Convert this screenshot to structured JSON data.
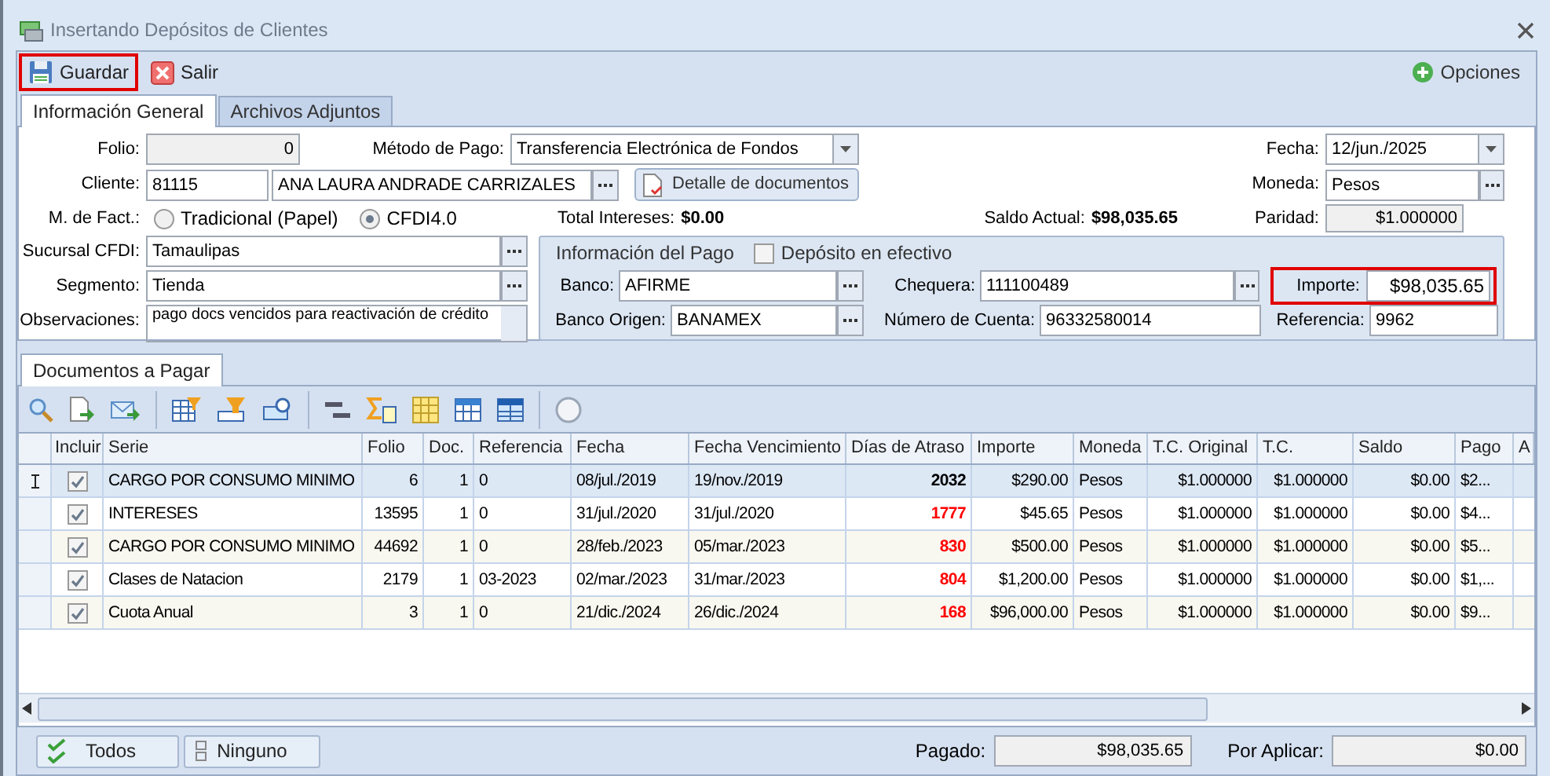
{
  "window": {
    "title": "Insertando Depósitos de Clientes"
  },
  "toolbar": {
    "buttons": [
      {
        "label": "Guardar",
        "highlighted": true
      },
      {
        "label": "Salir",
        "highlighted": false
      }
    ],
    "options": "Opciones"
  },
  "tabs": [
    {
      "label": "Información General",
      "selected": true
    },
    {
      "label": "Archivos Adjuntos",
      "selected": false
    }
  ],
  "form": {
    "folio": {
      "label": "Folio:",
      "value": "0"
    },
    "metodo_pago": {
      "label": "Método de Pago:",
      "value": "Transferencia Electrónica de Fondos"
    },
    "fecha": {
      "label": "Fecha:",
      "value": "12/jun./2025"
    },
    "cliente": {
      "label": "Cliente:",
      "code": "81115",
      "name": "ANA LAURA ANDRADE CARRIZALES"
    },
    "detalle_button": "Detalle de documentos",
    "moneda": {
      "label": "Moneda:",
      "value": "Pesos"
    },
    "m_fact": {
      "label": "M. de Fact.:",
      "options": [
        {
          "label": "Tradicional (Papel)",
          "selected": false
        },
        {
          "label": "CFDI4.0",
          "selected": true
        }
      ]
    },
    "total_intereses": {
      "label": "Total Intereses:",
      "value": "$0.00"
    },
    "saldo_actual": {
      "label": "Saldo Actual:",
      "value": "$98,035.65"
    },
    "paridad": {
      "label": "Paridad:",
      "value": "$1.000000"
    },
    "sucursal": {
      "label": "Sucursal CFDI:",
      "value": "Tamaulipas"
    },
    "segmento": {
      "label": "Segmento:",
      "value": "Tienda"
    },
    "observaciones": {
      "label": "Observaciones:",
      "value": "pago docs vencidos para reactivación de crédito"
    }
  },
  "pago": {
    "title": "Información del Pago",
    "efectivo": {
      "label": "Depósito en efectivo",
      "checked": false
    },
    "banco": {
      "label": "Banco:",
      "value": "AFIRME"
    },
    "chequera": {
      "label": "Chequera:",
      "value": "111100489"
    },
    "importe": {
      "label": "Importe:",
      "value": "$98,035.65",
      "highlighted": true
    },
    "banco_origen": {
      "label": "Banco Origen:",
      "value": "BANAMEX"
    },
    "numero_cuenta": {
      "label": "Número de Cuenta:",
      "value": "96332580014"
    },
    "referencia": {
      "label": "Referencia:",
      "value": "9962"
    }
  },
  "grid": {
    "tabs": [
      {
        "label": "Documentos a Pagar",
        "selected": true
      }
    ],
    "incluir_header": "Incluir",
    "columns": [
      "Serie",
      "Folio",
      "Doc.",
      "Referencia",
      "Fecha",
      "Fecha Vencimiento",
      "Días de Atraso",
      "Importe",
      "Moneda",
      "T.C. Original",
      "T.C.",
      "Saldo",
      "Pago",
      "A"
    ],
    "rows": [
      {
        "selected": true,
        "incluir": true,
        "color": "#000000",
        "cells": [
          "CARGO POR CONSUMO MINIMO",
          "6",
          "1",
          "0",
          "08/jul./2019",
          "19/nov./2019",
          "2032",
          "$290.00",
          "Pesos",
          "$1.000000",
          "$1.000000",
          "$0.00",
          "$2..."
        ]
      },
      {
        "selected": false,
        "incluir": true,
        "color": "#ff0000",
        "cells": [
          "INTERESES",
          "13595",
          "1",
          "0",
          "31/jul./2020",
          "31/jul./2020",
          "1777",
          "$45.65",
          "Pesos",
          "$1.000000",
          "$1.000000",
          "$0.00",
          "$4..."
        ]
      },
      {
        "selected": false,
        "incluir": true,
        "color": "#ff0000",
        "cells": [
          "CARGO POR CONSUMO MINIMO",
          "44692",
          "1",
          "0",
          "28/feb./2023",
          "05/mar./2023",
          "830",
          "$500.00",
          "Pesos",
          "$1.000000",
          "$1.000000",
          "$0.00",
          "$5..."
        ]
      },
      {
        "selected": false,
        "incluir": true,
        "color": "#ff0000",
        "cells": [
          "Clases de Natacion",
          "2179",
          "1",
          "03-2023",
          "02/mar./2023",
          "31/mar./2023",
          "804",
          "$1,200.00",
          "Pesos",
          "$1.000000",
          "$1.000000",
          "$0.00",
          "$1,..."
        ]
      },
      {
        "selected": false,
        "incluir": true,
        "color": "#ff0000",
        "cells": [
          "Cuota Anual",
          "3",
          "1",
          "0",
          "21/dic./2024",
          "26/dic./2024",
          "168",
          "$96,000.00",
          "Pesos",
          "$1.000000",
          "$1.000000",
          "$0.00",
          "$9..."
        ]
      }
    ]
  },
  "footer": {
    "buttons": [
      "Todos",
      "Ninguno"
    ],
    "pagado": {
      "label": "Pagado:",
      "value": "$98,035.65"
    },
    "por_aplicar": {
      "label": "Por Aplicar:",
      "value": "$0.00"
    }
  }
}
